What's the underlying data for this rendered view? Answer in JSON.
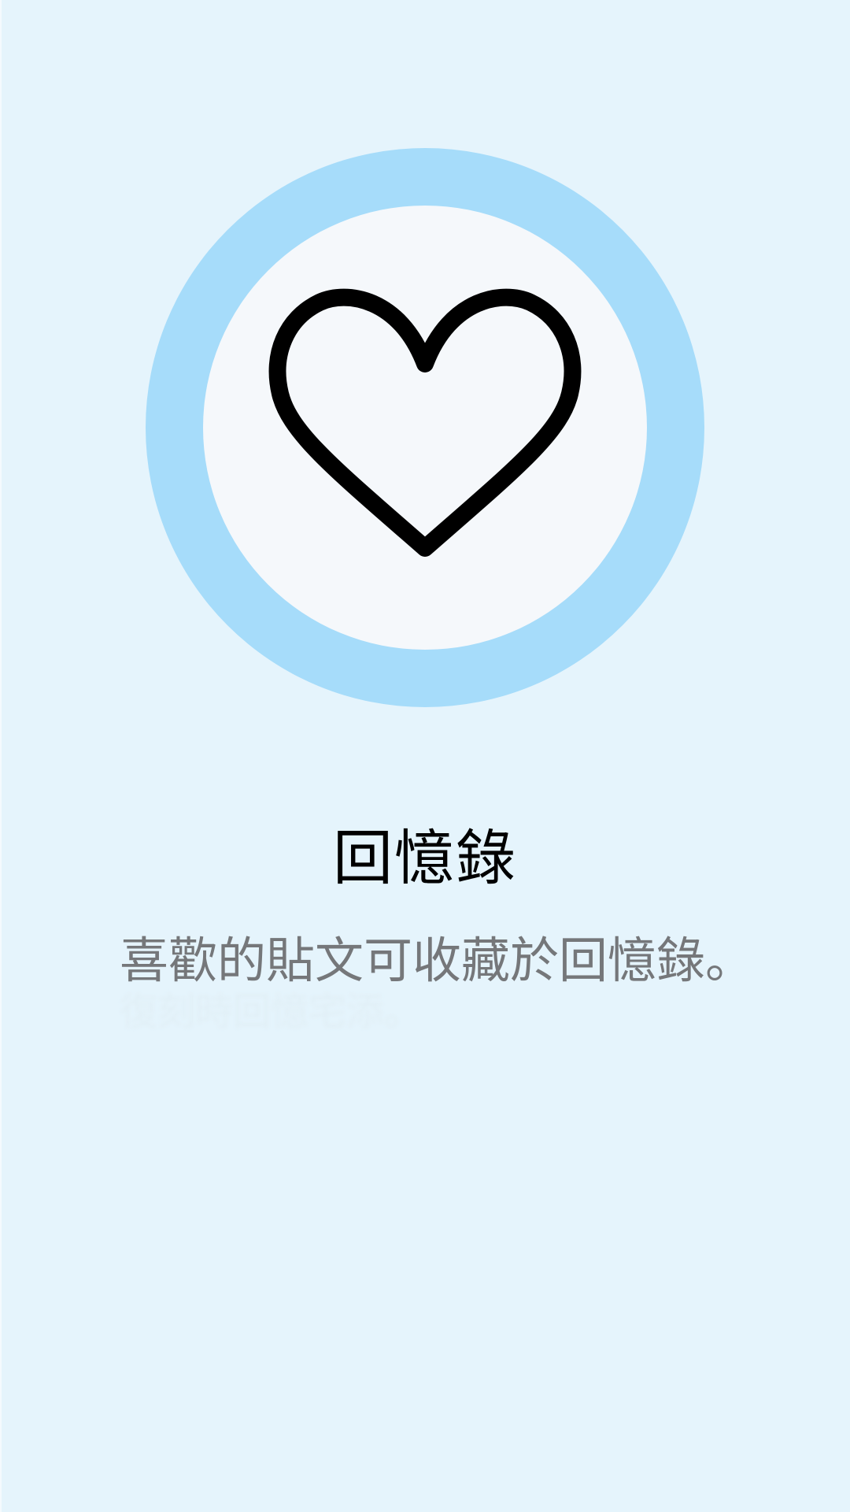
{
  "icon": "heart-icon",
  "colors": {
    "background": "#e5f4fc",
    "ring": "#a6dcfa",
    "inner_circle": "#f5f8fb",
    "title": "#000000",
    "description": "#75777a"
  },
  "empty_state": {
    "title": "回憶錄",
    "description": "喜歡的貼文可收藏於回憶錄。",
    "description_faded": "復刻時回憶宅添。"
  }
}
